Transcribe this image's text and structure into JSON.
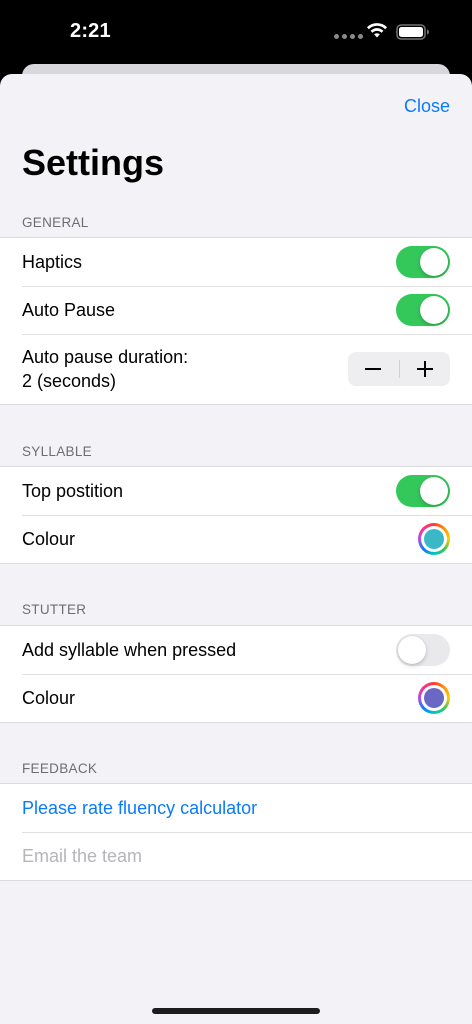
{
  "status_bar": {
    "time": "2:21",
    "icons": [
      "signal-dots-icon",
      "wifi-icon",
      "battery-icon"
    ]
  },
  "header": {
    "close_label": "Close",
    "title": "Settings"
  },
  "colors": {
    "accent": "#0a7aff",
    "toggle_on": "#34c759",
    "syllable_colour": "#3ab8c8",
    "stutter_colour": "#6a68c4"
  },
  "general": {
    "header": "GENERAL",
    "haptics_label": "Haptics",
    "haptics_on": true,
    "auto_pause_label": "Auto Pause",
    "auto_pause_on": true,
    "duration_line1": "Auto pause duration:",
    "duration_line2": "2 (seconds)"
  },
  "syllable": {
    "header": "SYLLABLE",
    "top_position_label": "Top postition",
    "top_position_on": true,
    "colour_label": "Colour"
  },
  "stutter": {
    "header": "STUTTER",
    "add_syllable_label": "Add syllable when pressed",
    "add_syllable_on": false,
    "colour_label": "Colour"
  },
  "feedback": {
    "header": "FEEDBACK",
    "rate_label": "Please rate fluency calculator",
    "email_label": "Email the team"
  }
}
